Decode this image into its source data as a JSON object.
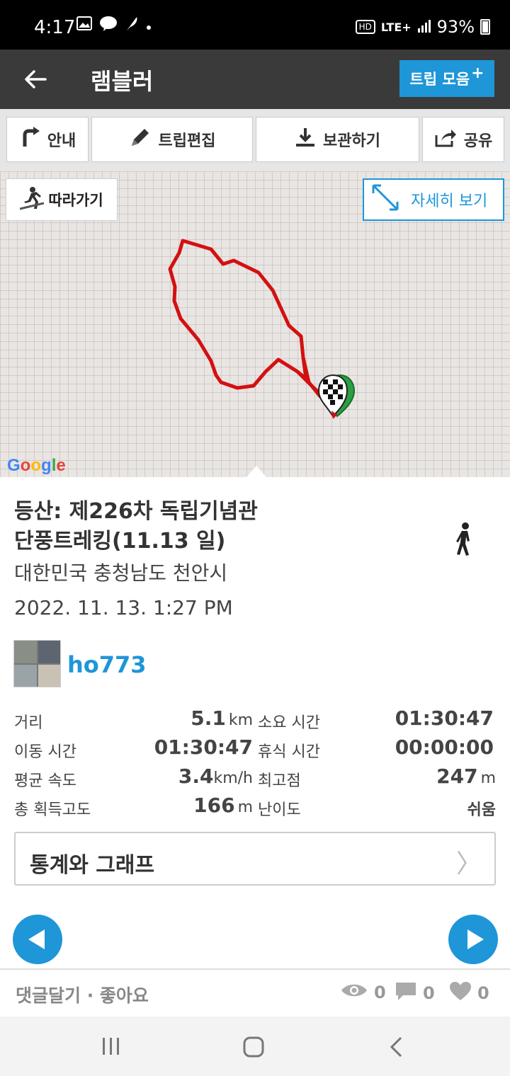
{
  "status_bar": {
    "time": "4:17",
    "hd": "HD",
    "network": "LTE+",
    "battery": "93%"
  },
  "header": {
    "title": "램블러",
    "trip_collection": "트립 모음",
    "trip_collection_plus": "+"
  },
  "toolbar": {
    "guide": "안내",
    "edit_trip": "트립편집",
    "save": "보관하기",
    "share": "공유"
  },
  "map": {
    "follow": "따라가기",
    "view_detail": "자세히 보기",
    "provider": "Google",
    "route_color": "#d31010"
  },
  "trip": {
    "title_line1": "등산: 제226차 독립기념관",
    "title_line2": "단풍트레킹(11.13 일)",
    "location": "대한민국 충청남도 천안시",
    "datetime": "2022. 11. 13. 1:27 PM",
    "user": "ho773"
  },
  "stats": {
    "distance": {
      "label": "거리",
      "value": "5.1",
      "unit": "km"
    },
    "duration": {
      "label": "소요 시간",
      "value": "01:30:47"
    },
    "moving_time": {
      "label": "이동 시간",
      "value": "01:30:47"
    },
    "rest_time": {
      "label": "휴식 시간",
      "value": "00:00:00"
    },
    "avg_speed": {
      "label": "평균 속도",
      "value": "3.4",
      "unit": "km/h"
    },
    "highest": {
      "label": "최고점",
      "value": "247",
      "unit": "m"
    },
    "total_ascent": {
      "label": "총 획득고도",
      "value": "166",
      "unit": "m"
    },
    "difficulty": {
      "label": "난이도",
      "value": "쉬움"
    }
  },
  "stats_graph": {
    "label": "통계와 그래프",
    "chevron": "〉"
  },
  "bottom": {
    "comment_like": "댓글달기 · 좋아요",
    "views": "0",
    "comments": "0",
    "likes": "0"
  },
  "colors": {
    "accent": "#1e96d8",
    "header_bg": "#3a3a3a"
  }
}
